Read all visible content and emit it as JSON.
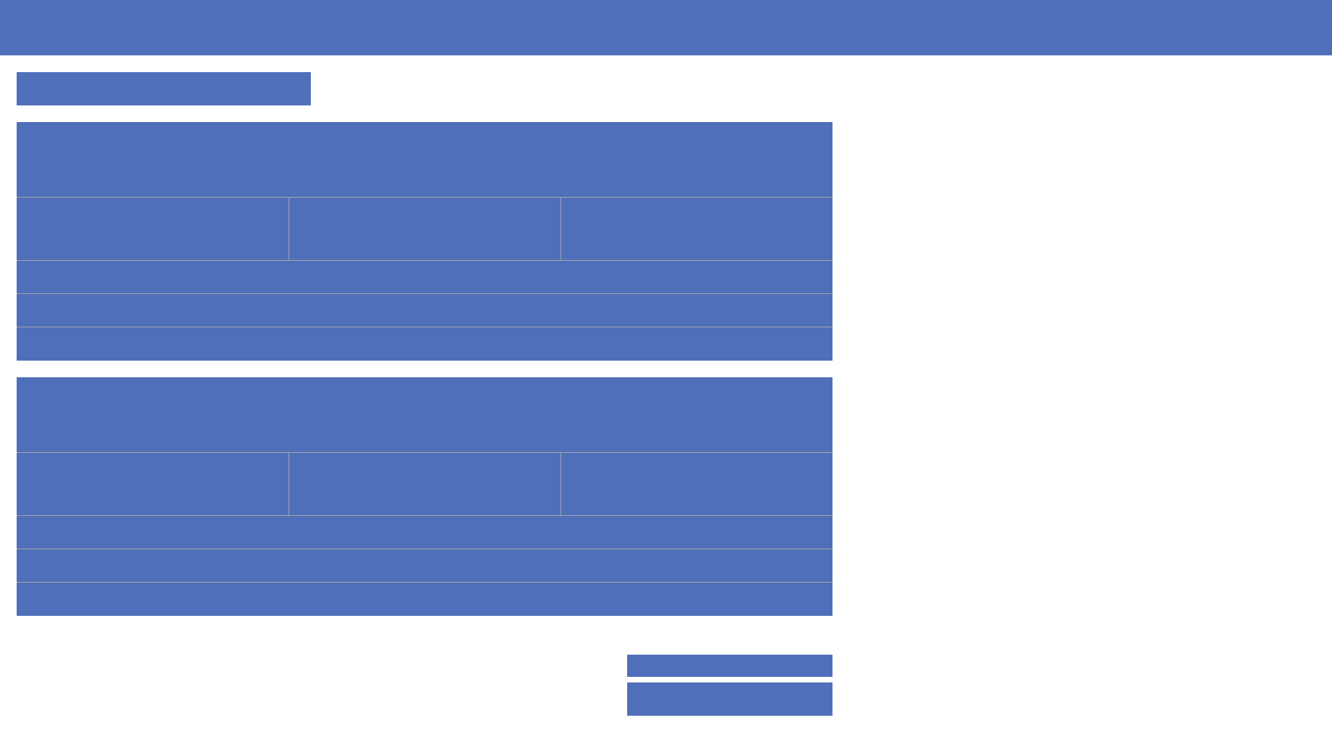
{
  "colors": {
    "accent": "#506fba",
    "divider": "#a7a7a7",
    "background": "#ffffff"
  },
  "header": {
    "title": ""
  },
  "page": {
    "title": ""
  },
  "cards": [
    {
      "heading": "",
      "cells": [
        "",
        "",
        ""
      ],
      "rows": [
        "",
        "",
        ""
      ]
    },
    {
      "heading": "",
      "cells": [
        "",
        "",
        ""
      ],
      "rows": [
        "",
        "",
        ""
      ]
    }
  ],
  "footer": {
    "item_1": "",
    "item_2": ""
  }
}
